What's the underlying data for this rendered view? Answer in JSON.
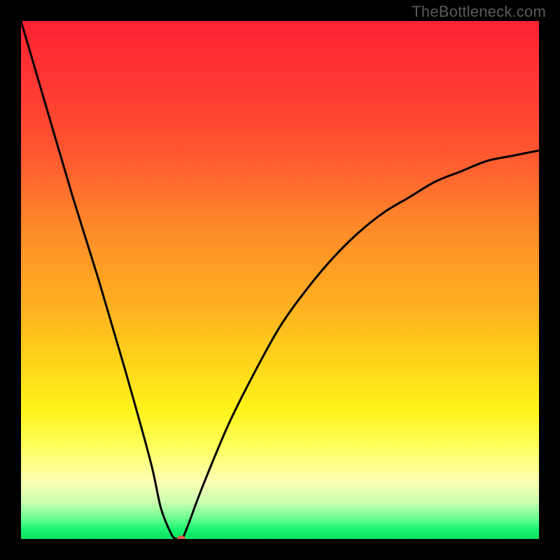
{
  "watermark": "TheBottleneck.com",
  "colors": {
    "watermark": "#5a5a5a",
    "curve": "#000000",
    "marker": "#e15b4f",
    "gradient_top": "#ff2233",
    "gradient_bottom": "#08e060",
    "frame_bg": "#000000"
  },
  "chart_data": {
    "type": "line",
    "title": "",
    "xlabel": "",
    "ylabel": "",
    "xlim": [
      0,
      100
    ],
    "ylim": [
      0,
      100
    ],
    "grid": false,
    "legend": "none",
    "x": [
      0,
      5,
      10,
      15,
      20,
      25,
      27,
      29,
      30,
      31,
      32,
      35,
      40,
      45,
      50,
      55,
      60,
      65,
      70,
      75,
      80,
      85,
      90,
      95,
      100
    ],
    "values": [
      100,
      83,
      66,
      50,
      33,
      15,
      6,
      1,
      0,
      0,
      2,
      10,
      22,
      32,
      41,
      48,
      54,
      59,
      63,
      66,
      69,
      71,
      73,
      74,
      75
    ],
    "series": [
      {
        "name": "bottleneck-curve",
        "x": [
          0,
          5,
          10,
          15,
          20,
          25,
          27,
          29,
          30,
          31,
          32,
          35,
          40,
          45,
          50,
          55,
          60,
          65,
          70,
          75,
          80,
          85,
          90,
          95,
          100
        ],
        "values": [
          100,
          83,
          66,
          50,
          33,
          15,
          6,
          1,
          0,
          0,
          2,
          10,
          22,
          32,
          41,
          48,
          54,
          59,
          63,
          66,
          69,
          71,
          73,
          74,
          75
        ]
      }
    ],
    "marker": {
      "x": 31,
      "y": 0
    }
  }
}
